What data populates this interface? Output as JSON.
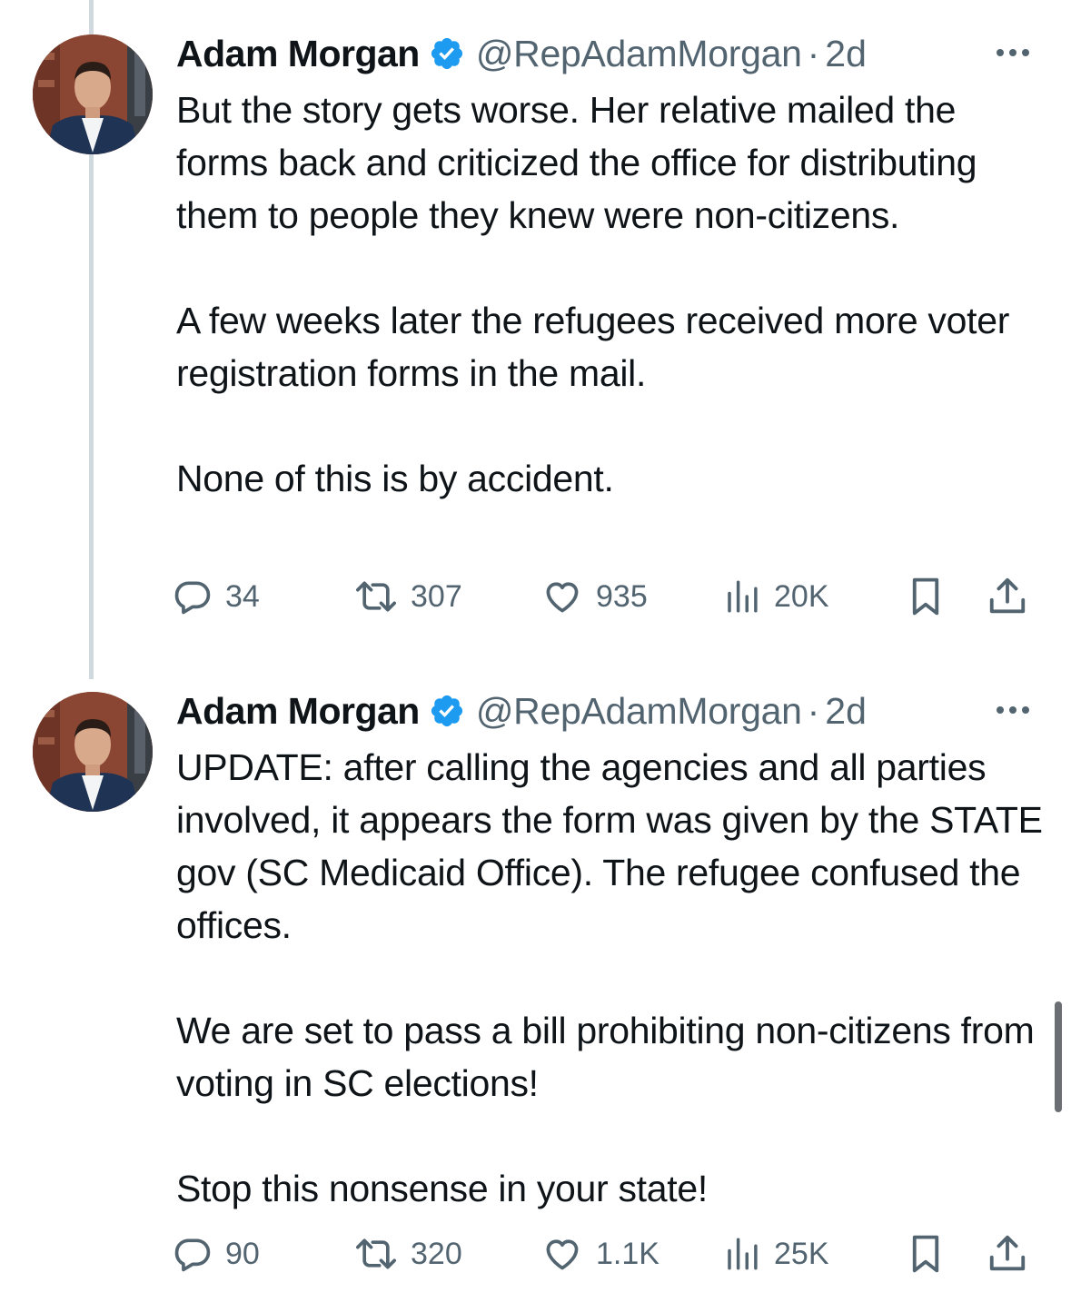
{
  "colors": {
    "text_primary": "#0f1419",
    "text_secondary": "#536471",
    "verified_blue": "#1d9bf0",
    "thread_line": "#cfd9de"
  },
  "tweets": [
    {
      "author_name": "Adam Morgan",
      "handle": "@RepAdamMorgan",
      "separator": "·",
      "time": "2d",
      "paragraphs": [
        "But the story gets worse. Her relative mailed the forms back and criticized the office for distributing them to people they knew were non-citizens.",
        "A few weeks later the refugees received more voter registration forms in the mail.",
        "None of this is by accident."
      ],
      "replies": "34",
      "reposts": "307",
      "likes": "935",
      "views": "20K"
    },
    {
      "author_name": "Adam Morgan",
      "handle": "@RepAdamMorgan",
      "separator": "·",
      "time": "2d",
      "paragraphs": [
        "UPDATE: after calling the agencies and all parties involved, it appears the form was given by the STATE gov (SC Medicaid Office). The refugee confused the offices.",
        "We are set to pass a bill prohibiting non-citizens from voting in SC elections!",
        "Stop this nonsense in your state!"
      ],
      "replies": "90",
      "reposts": "320",
      "likes": "1.1K",
      "views": "25K"
    }
  ],
  "icons": {
    "avatar": "avatar",
    "verified": "verified-badge-icon",
    "more": "more-options-icon",
    "reply": "reply-icon",
    "repost": "repost-icon",
    "like": "heart-icon",
    "views": "views-chart-icon",
    "bookmark": "bookmark-icon",
    "share": "share-icon"
  }
}
